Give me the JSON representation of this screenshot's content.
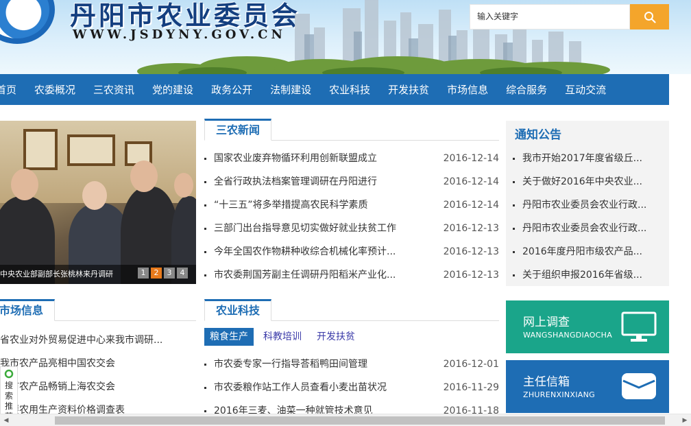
{
  "header": {
    "site_title": "丹阳市农业委员会",
    "site_url": "WWW.JSDYNY.GOV.CN",
    "search_placeholder": "输入关键字"
  },
  "nav": [
    "首页",
    "农委概况",
    "三农资讯",
    "党的建设",
    "政务公开",
    "法制建设",
    "农业科技",
    "开发扶贫",
    "市场信息",
    "综合服务",
    "互动交流"
  ],
  "slider": {
    "caption": "中央农业部副部长张桃林来丹调研",
    "dots": [
      "1",
      "2",
      "3",
      "4"
    ],
    "active_dot": 1
  },
  "news": {
    "tab": "三农新闻",
    "items": [
      {
        "title": "国家农业废弃物循环利用创新联盟成立",
        "date": "2016-12-14"
      },
      {
        "title": "全省行政执法档案管理调研在丹阳进行",
        "date": "2016-12-14"
      },
      {
        "title": "“十三五”将多举措提高农民科学素质",
        "date": "2016-12-14"
      },
      {
        "title": "三部门出台指导意见切实做好就业扶贫工作",
        "date": "2016-12-13"
      },
      {
        "title": "今年全国农作物耕种收综合机械化率预计...",
        "date": "2016-12-13"
      },
      {
        "title": "市农委荆国芳副主任调研丹阳稻米产业化...",
        "date": "2016-12-13"
      }
    ]
  },
  "notice": {
    "title": "通知公告",
    "items": [
      "我市开始2017年度省级丘...",
      "关于做好2016年中央农业...",
      "丹阳市农业委员会农业行政...",
      "丹阳市农业委员会农业行政...",
      "2016年度丹阳市级农产品...",
      "关于组织申报2016年省级..."
    ]
  },
  "market": {
    "tab": "市场信息",
    "items": [
      "省农业对外贸易促进中心来我市调研...",
      "我市农产品亮相中国农交会",
      "我市农产品畅销上海农交会",
      "主要农用生产资料价格调查表"
    ]
  },
  "tech": {
    "tab": "农业科技",
    "subtabs": [
      "粮食生产",
      "科教培训",
      "开发扶贫"
    ],
    "active_subtab": 0,
    "items": [
      {
        "title": "市农委专家一行指导荅稻鸭田间管理",
        "date": "2016-12-01"
      },
      {
        "title": "市农委粮作站工作人员查看小麦出苗状况",
        "date": "2016-11-29"
      },
      {
        "title": "2016年三麦、油菜一种就管技术意见",
        "date": "2016-11-18"
      }
    ]
  },
  "features": [
    {
      "title": "网上调查",
      "subtitle": "WANGSHANGDIAOCHA",
      "color": "#1aa58a"
    },
    {
      "title": "主任信箱",
      "subtitle": "ZHURENXINXIANG",
      "color": "#1e6db4"
    }
  ],
  "float_search": {
    "label": "搜索推荐"
  }
}
